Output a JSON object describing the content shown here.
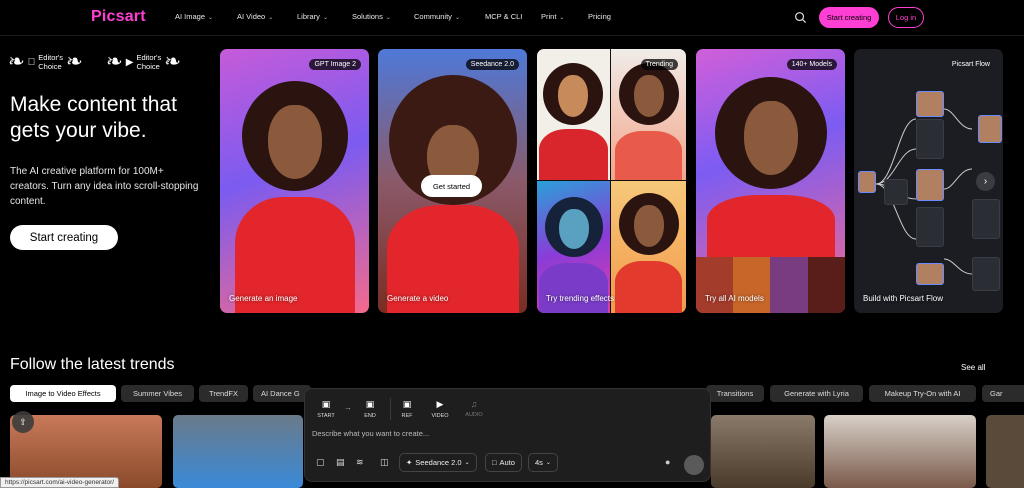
{
  "nav": {
    "logo": "Picsart",
    "items": [
      {
        "label": "AI Image",
        "chevron": true
      },
      {
        "label": "AI Video",
        "chevron": true
      },
      {
        "label": "Library",
        "chevron": true
      },
      {
        "label": "Solutions",
        "chevron": true
      },
      {
        "label": "Community",
        "chevron": true
      },
      {
        "label": "MCP & CLI",
        "chevron": false
      },
      {
        "label": "Print",
        "chevron": true
      },
      {
        "label": "Pricing",
        "chevron": false
      }
    ],
    "start_creating": "Start creating",
    "login": "Log in",
    "accent_color": "#ff3fd3"
  },
  "hero": {
    "awards": [
      {
        "platform_icon": "apple-icon",
        "line1": "Editor's",
        "line2": "Choice"
      },
      {
        "platform_icon": "google-play-icon",
        "line1": "Editor's",
        "line2": "Choice"
      }
    ],
    "title_line1": "Make content that",
    "title_line2": "gets your vibe.",
    "subtitle": "The AI creative platform for 100M+ creators. Turn any idea into scroll-stopping content.",
    "cta": "Start creating"
  },
  "cards": [
    {
      "badge": "GPT Image 2",
      "caption": "Generate an image"
    },
    {
      "badge": "Seedance 2.0",
      "caption": "Generate a video",
      "overlay_button": "Get started"
    },
    {
      "badge": "Trending",
      "caption": "Try trending effects"
    },
    {
      "badge": "140+ Models",
      "caption": "Try all AI models"
    },
    {
      "badge": "Picsart Flow",
      "caption": "Build with Picsart Flow",
      "header": "Picsart Flow"
    }
  ],
  "trends": {
    "title": "Follow the latest trends",
    "see_all": "See all",
    "chips": [
      "Image to Video Effects",
      "Summer Vibes",
      "TrendFX",
      "AI Dance G",
      "Transitions",
      "Generate with Lyria",
      "Makeup Try-On with AI",
      "Gar"
    ]
  },
  "prompt_panel": {
    "tools": [
      {
        "label": "START",
        "icon": "image-plus-icon"
      },
      {
        "label": "END",
        "icon": "image-plus-icon"
      },
      {
        "label": "REF",
        "icon": "image-plus-icon"
      },
      {
        "label": "VIDEO",
        "icon": "video-icon"
      },
      {
        "label": "AUDIO",
        "icon": "music-icon"
      }
    ],
    "placeholder": "Describe what you want to create...",
    "model": "Seedance 2.0",
    "aspect": "Auto",
    "duration": "4s"
  },
  "status_url": "https://picsart.com/ai-video-generator/"
}
